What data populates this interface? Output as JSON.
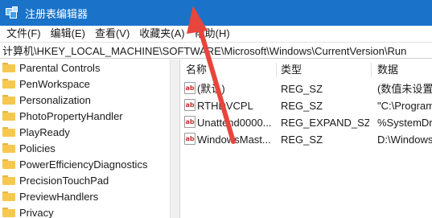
{
  "window": {
    "title": "注册表编辑器"
  },
  "menu": [
    "文件(F)",
    "编辑(E)",
    "查看(V)",
    "收藏夹(A)",
    "帮助(H)"
  ],
  "address": "计算机\\HKEY_LOCAL_MACHINE\\SOFTWARE\\Microsoft\\Windows\\CurrentVersion\\Run",
  "tree": [
    "Parental Controls",
    "PenWorkspace",
    "Personalization",
    "PhotoPropertyHandler",
    "PlayReady",
    "Policies",
    "PowerEfficiencyDiagnostics",
    "PrecisionTouchPad",
    "PreviewHandlers",
    "Privacy"
  ],
  "columns": {
    "name": "名称",
    "type": "类型",
    "data": "数据"
  },
  "values": [
    {
      "icon": "ab",
      "name": "(默认)",
      "type": "REG_SZ",
      "data": "(数值未设置)"
    },
    {
      "icon": "ab",
      "name": "RTHDVCPL",
      "type": "REG_SZ",
      "data": "\"C:\\Program"
    },
    {
      "icon": "ab",
      "name": "Unattend0000...",
      "type": "REG_EXPAND_SZ",
      "data": "%SystemDri"
    },
    {
      "icon": "ab",
      "name": "WindowsMast...",
      "type": "REG_SZ",
      "data": "D:\\Windows"
    }
  ],
  "colors": {
    "titlebar": "#1a73c9",
    "arrow": "#e8453c",
    "folder": "#f5c94e"
  },
  "icons": [
    "registry-app-icon",
    "folder-icon",
    "reg-string-icon",
    "red-arrow-annotation"
  ]
}
